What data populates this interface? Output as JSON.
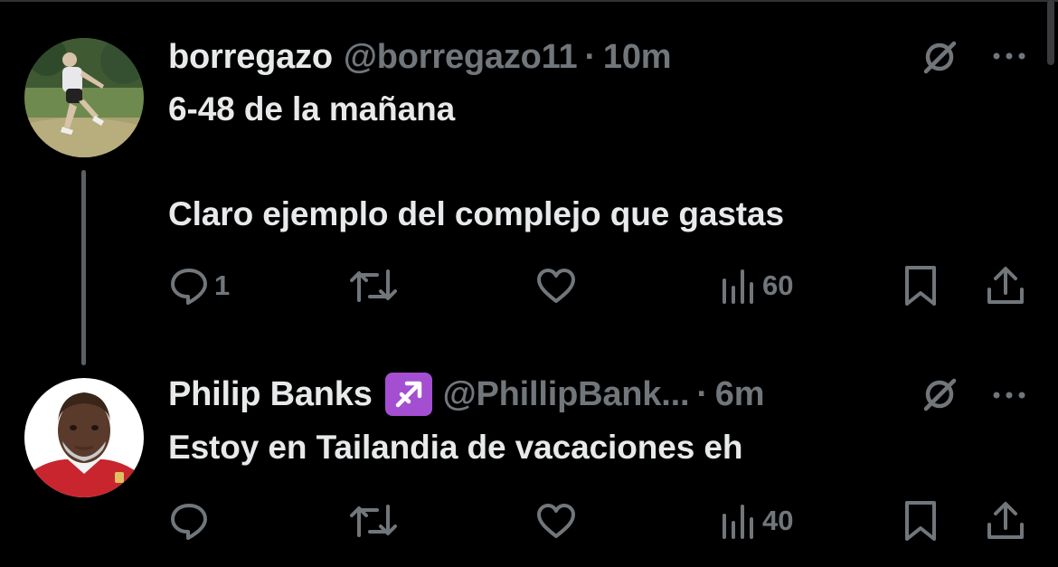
{
  "tweets": [
    {
      "name": "borregazo",
      "handle": "@borregazo11",
      "separator": "·",
      "time": "10m",
      "text_line1": "6-48 de la mañana",
      "text_line2": "Claro ejemplo del complejo que gastas",
      "replies": "1",
      "reposts": "",
      "likes": "",
      "views": "60",
      "avatar_icon": "cyclist-photo-avatar"
    },
    {
      "name": "Philip Banks",
      "badge_icon": "sagittarius-emoji",
      "handle": "@PhillipBank...",
      "separator": "·",
      "time": "6m",
      "text_line1": "Estoy en Tailandia de vacaciones eh",
      "replies": "",
      "reposts": "",
      "likes": "",
      "views": "40",
      "avatar_icon": "man-photo-avatar"
    }
  ],
  "colors": {
    "background": "#000000",
    "text_primary": "#e7e9ea",
    "text_secondary": "#71767b",
    "badge": "#a44ed1"
  }
}
